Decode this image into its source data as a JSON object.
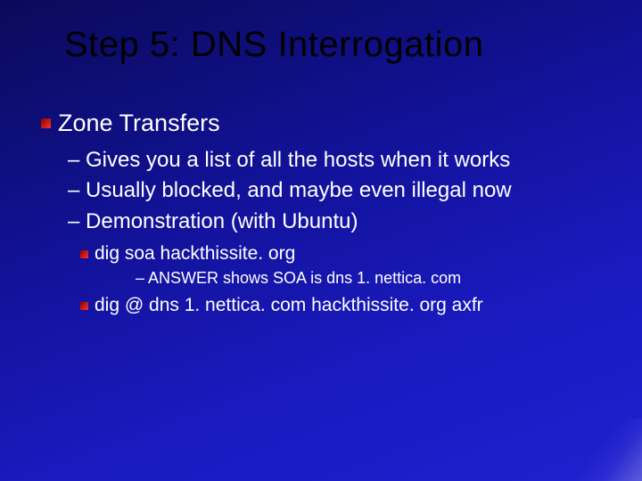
{
  "title": "Step 5: DNS Interrogation",
  "level1": "Zone Transfers",
  "level2": {
    "a": "– Gives you a list of all the hosts when it works",
    "b": "– Usually blocked, and maybe even illegal now",
    "c": "– Demonstration (with Ubuntu)"
  },
  "level3": {
    "a": "dig soa hackthissite. org",
    "b": "dig @ dns 1. nettica. com hackthissite. org axfr"
  },
  "level4": {
    "a": "– ANSWER shows SOA is dns 1. nettica. com"
  }
}
